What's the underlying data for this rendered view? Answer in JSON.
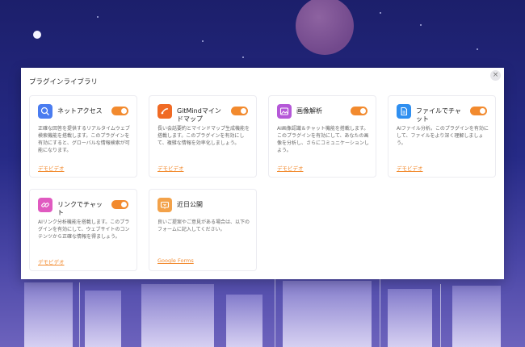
{
  "dialog": {
    "title": "プラグインライブラリ",
    "close_label": "×"
  },
  "colors": {
    "accent": "#f28a2e",
    "card_border": "#ececf1"
  },
  "plugins": [
    {
      "name": "ネットアクセス",
      "icon": "globe-search-icon",
      "enabled": true,
      "description": "正確な回答を提供するリアルタイムウェブ検索機能を搭載します。このプラグインを有効にすると、グローバルな情報検索が可能になります。",
      "link": "デモビデオ"
    },
    {
      "name": "GitMindマインドマップ",
      "icon": "gitmind-icon",
      "enabled": true,
      "description": "長い会話要約とマインドマップ生成機能を搭載します。このプラグインを有効にして、複雑な情報を効率化しましょう。",
      "link": "デモビデオ"
    },
    {
      "name": "画像解析",
      "icon": "image-icon",
      "enabled": true,
      "description": "AI画像認識＆チャット機能を搭載します。このプラグインを有効にして、あなたの画像を分析し、さらにコミュニケーションしよう。",
      "link": "デモビデオ"
    },
    {
      "name": "ファイルでチャット",
      "icon": "file-chat-icon",
      "enabled": true,
      "description": "AIファイル分析。このプラグインを有効にして、ファイルをより深く理解しましょう。",
      "link": "デモビデオ"
    },
    {
      "name": "リンクでチャット",
      "icon": "link-icon",
      "enabled": true,
      "description": "AIリンク分析機能を搭載します。このプラグインを有効にして、ウェブサイトのコンテンツから正確な情報を得ましょう。",
      "link": "デモビデオ"
    },
    {
      "name": "近日公開",
      "icon": "coming-soon-icon",
      "enabled": false,
      "description": "良いご提案やご意見がある場合は、以下のフォームに記入してください。",
      "link": "Google Forms"
    }
  ]
}
